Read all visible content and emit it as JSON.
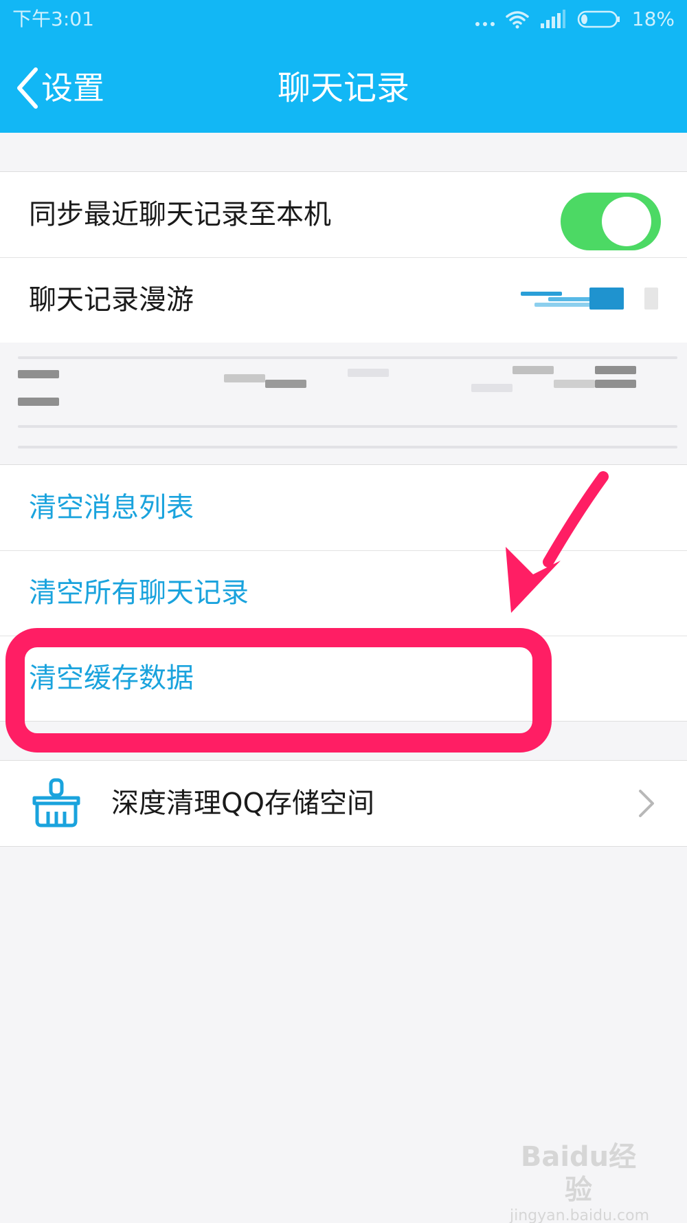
{
  "status_bar": {
    "time": "下午3:01",
    "battery_percent": "18%",
    "battery_level": 0.18,
    "icons": [
      "more-dots-icon",
      "wifi-icon",
      "signal-icon",
      "battery-icon"
    ]
  },
  "nav": {
    "back_label": "设置",
    "title": "聊天记录"
  },
  "settings": {
    "sync_label": "同步最近聊天记录至本机",
    "sync_enabled": true,
    "roaming_label": "聊天记录漫游"
  },
  "actions": {
    "clear_message_list": "清空消息列表",
    "clear_all_history": "清空所有聊天记录",
    "clear_cache": "清空缓存数据"
  },
  "deep_clean": {
    "label": "深度清理QQ存储空间",
    "icon": "broom-icon"
  },
  "watermark": {
    "line1": "Baidu经验",
    "line2": "jingyan.baidu.com"
  },
  "colors": {
    "header_bg": "#12b7f5",
    "toggle_on": "#4cd964",
    "action_text": "#1aa3dd",
    "annotation": "#ff1e64"
  }
}
